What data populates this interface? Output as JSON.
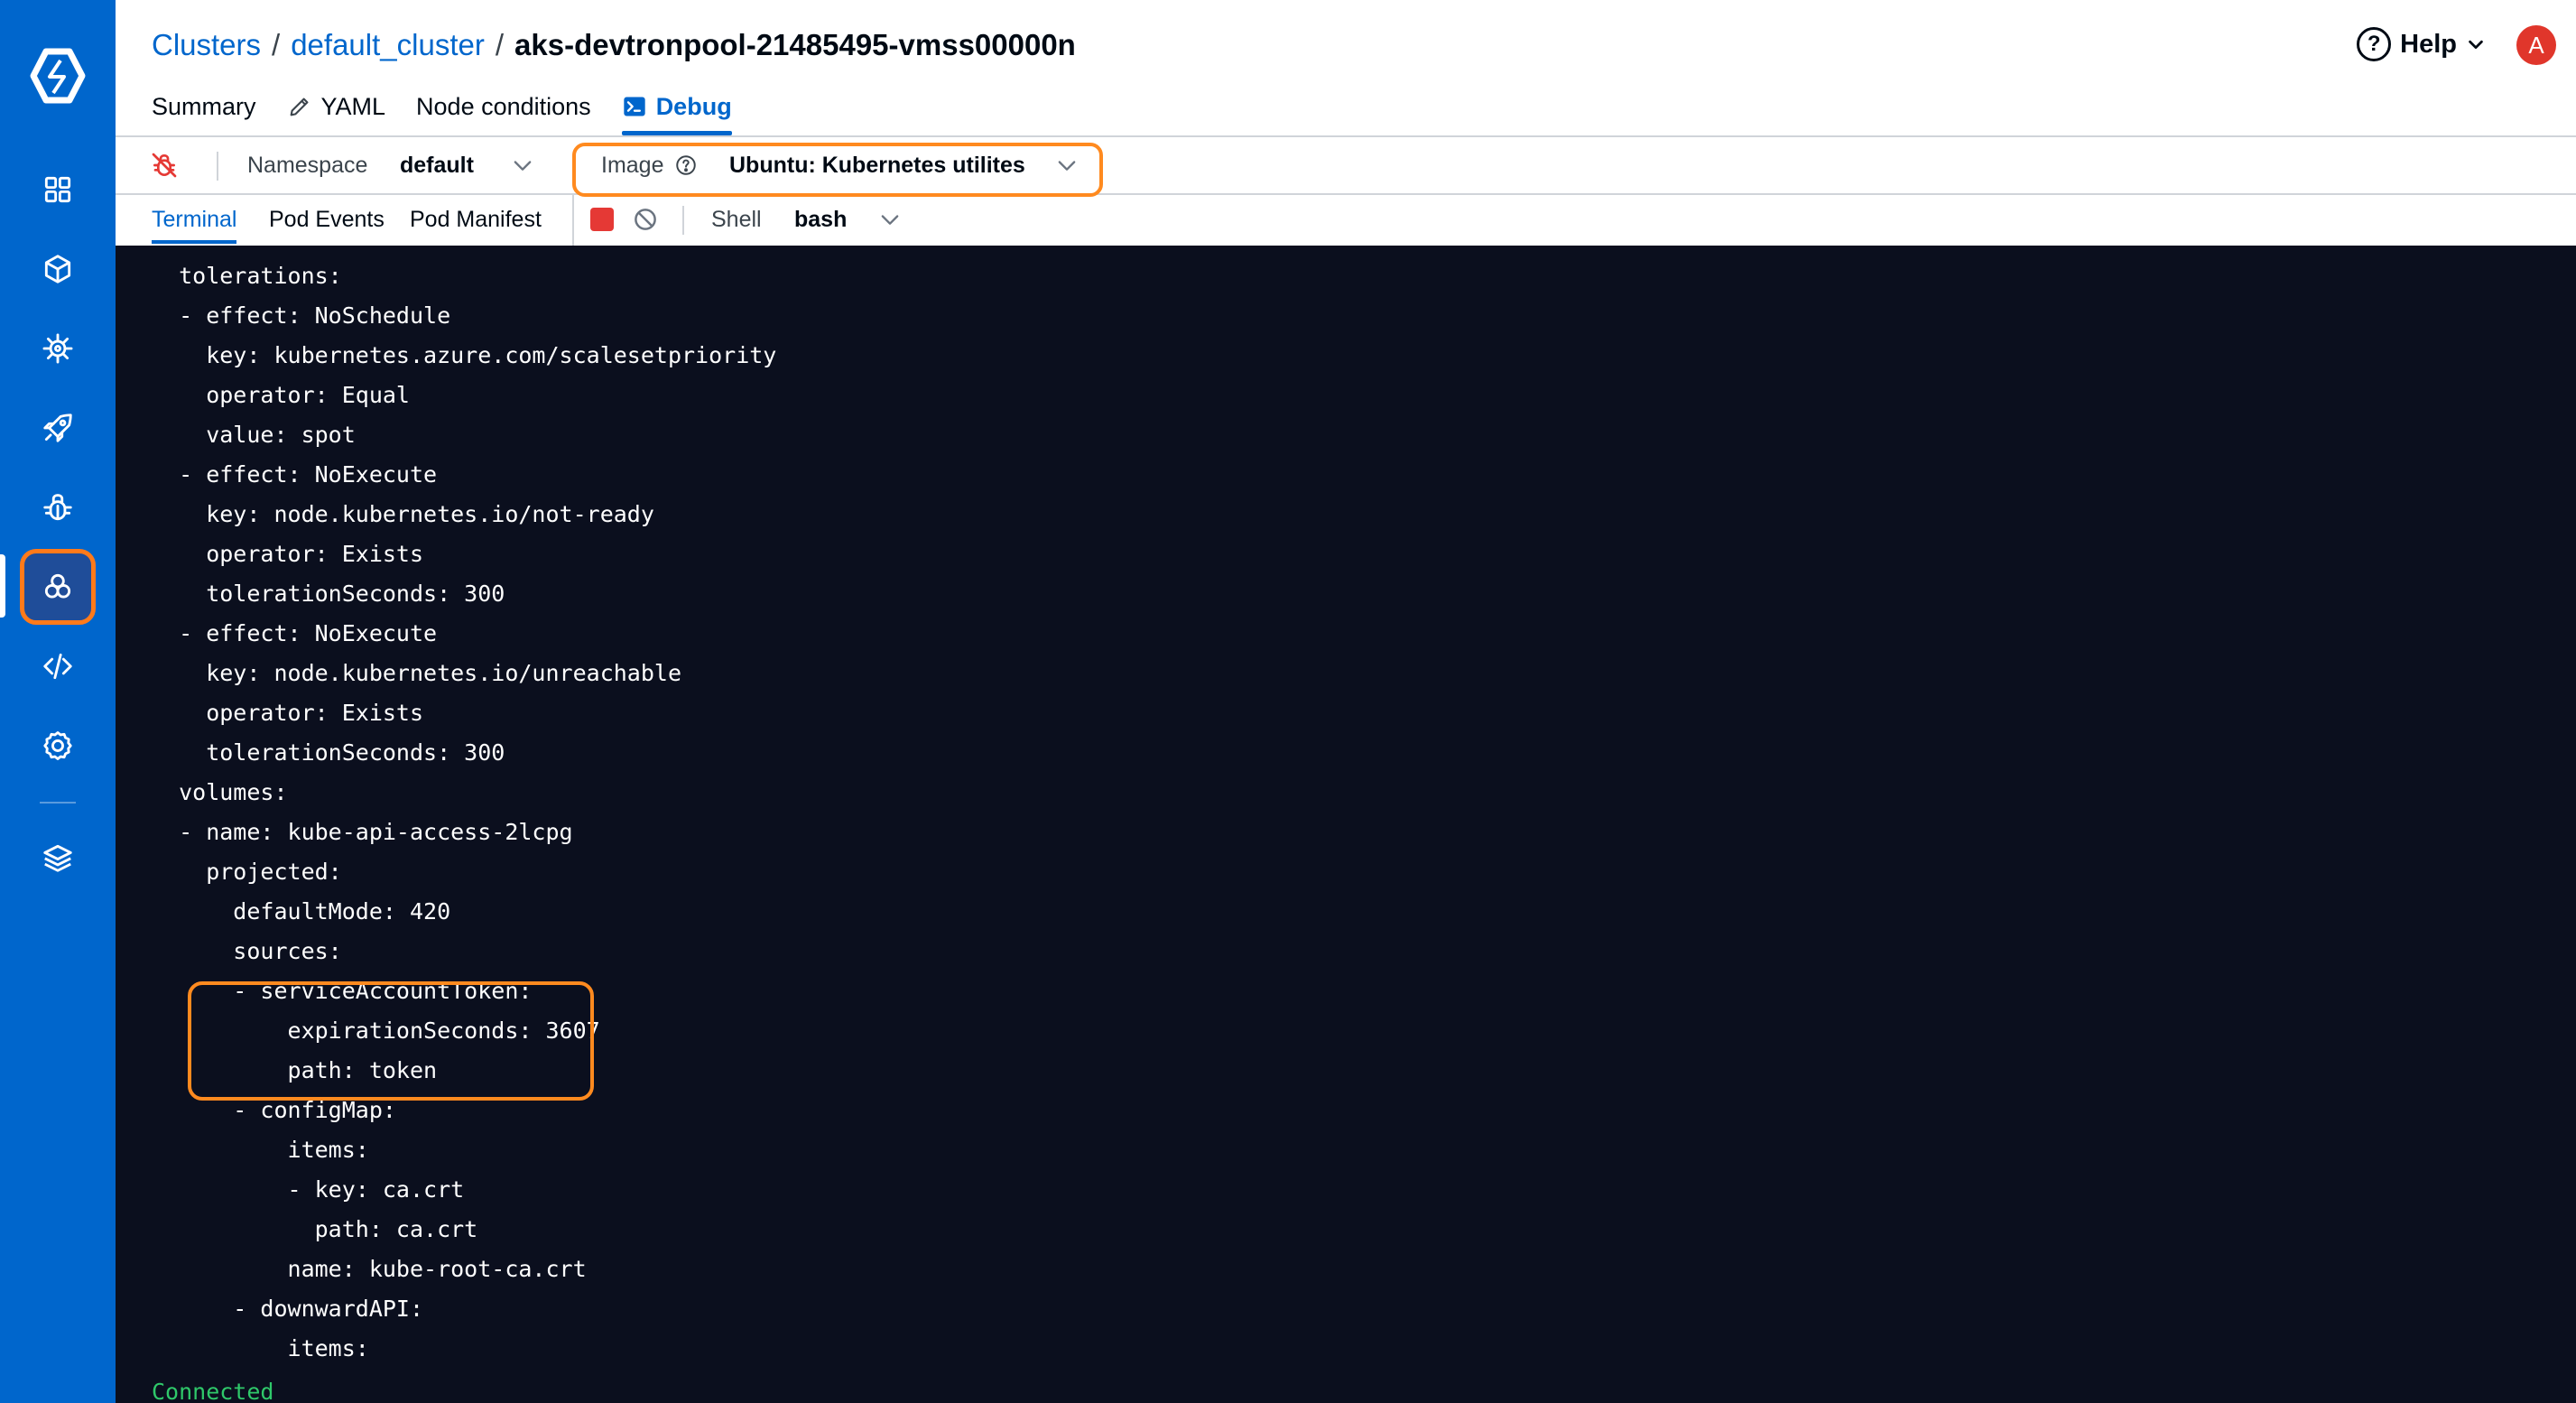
{
  "breadcrumb": {
    "items": [
      "Clusters",
      "default_cluster"
    ],
    "current": "aks-devtronpool-21485495-vmss00000n",
    "separator": "/"
  },
  "header": {
    "help_label": "Help",
    "avatar_initial": "A"
  },
  "tabs": [
    {
      "label": "Summary"
    },
    {
      "label": "YAML"
    },
    {
      "label": "Node conditions"
    },
    {
      "label": "Debug"
    }
  ],
  "toolbar": {
    "namespace_label": "Namespace",
    "namespace_value": "default",
    "image_label": "Image",
    "image_value": "Ubuntu: Kubernetes utilites"
  },
  "subtabs": [
    {
      "label": "Terminal"
    },
    {
      "label": "Pod Events"
    },
    {
      "label": "Pod Manifest"
    }
  ],
  "shell": {
    "label": "Shell",
    "value": "bash"
  },
  "terminal": {
    "lines": [
      "  tolerations:",
      "  - effect: NoSchedule",
      "    key: kubernetes.azure.com/scalesetpriority",
      "    operator: Equal",
      "    value: spot",
      "  - effect: NoExecute",
      "    key: node.kubernetes.io/not-ready",
      "    operator: Exists",
      "    tolerationSeconds: 300",
      "  - effect: NoExecute",
      "    key: node.kubernetes.io/unreachable",
      "    operator: Exists",
      "    tolerationSeconds: 300",
      "  volumes:",
      "  - name: kube-api-access-2lcpg",
      "    projected:",
      "      defaultMode: 420",
      "      sources:",
      "      - serviceAccountToken:",
      "          expirationSeconds: 3607",
      "          path: token",
      "      - configMap:",
      "          items:",
      "          - key: ca.crt",
      "            path: ca.crt",
      "          name: kube-root-ca.crt",
      "      - downwardAPI:",
      "          items:"
    ],
    "status": "Connected"
  },
  "colors": {
    "nav_bg": "#0066cc",
    "accent": "#0066cc",
    "highlight": "#ff8a1f",
    "terminal_bg": "#0b0f1e",
    "status_green": "#2fc86a",
    "stop_red": "#e53935"
  }
}
